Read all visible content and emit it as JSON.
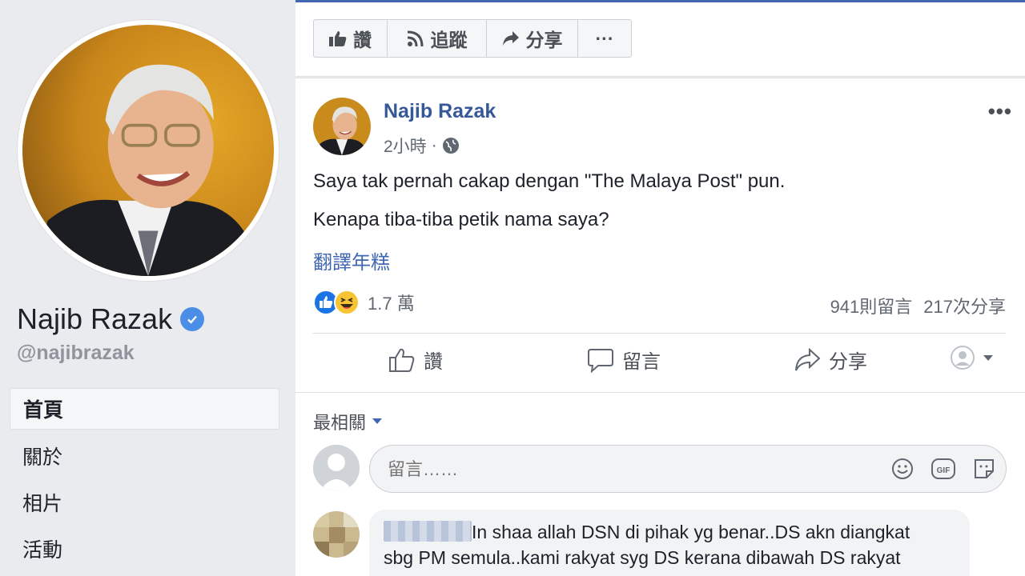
{
  "colors": {
    "link_blue": "#365899",
    "accent": "#4267b2",
    "verified": "#4b8ee8"
  },
  "profile": {
    "name": "Najib Razak",
    "handle": "@najibrazak",
    "verified_icon": "verified-badge-icon"
  },
  "nav": {
    "items": [
      {
        "label": "首頁",
        "active": true
      },
      {
        "label": "關於"
      },
      {
        "label": "相片"
      },
      {
        "label": "活動"
      }
    ]
  },
  "page_actions": {
    "like_label": "讚",
    "follow_label": "追蹤",
    "share_label": "分享",
    "more_label": "···"
  },
  "post": {
    "author": "Najib Razak",
    "time": "2小時",
    "separator": "·",
    "privacy_icon": "globe-icon",
    "more_label": "•••",
    "text_line1": "Saya tak pernah cakap dengan \"The Malaya Post\" pun.",
    "text_line2": "Kenapa tiba-tiba petik nama saya?",
    "translate_label": "翻譯年糕",
    "reaction_count": "1.7 萬",
    "reaction_icons": [
      "like-reaction-icon",
      "haha-reaction-icon"
    ],
    "comment_count": "941則留言",
    "share_count": "217次分享",
    "actions": {
      "like_label": "讚",
      "comment_label": "留言",
      "share_label": "分享"
    }
  },
  "comments": {
    "sort_label": "最相關",
    "input_placeholder": "留言……",
    "input_icons": [
      "emoji-icon",
      "gif-icon",
      "sticker-icon"
    ],
    "first_comment": {
      "line1": "In shaa allah DSN di pihak yg benar..DS akn diangkat",
      "line2": "sbg PM semula..kami rakyat syg DS kerana dibawah DS rakyat"
    }
  }
}
